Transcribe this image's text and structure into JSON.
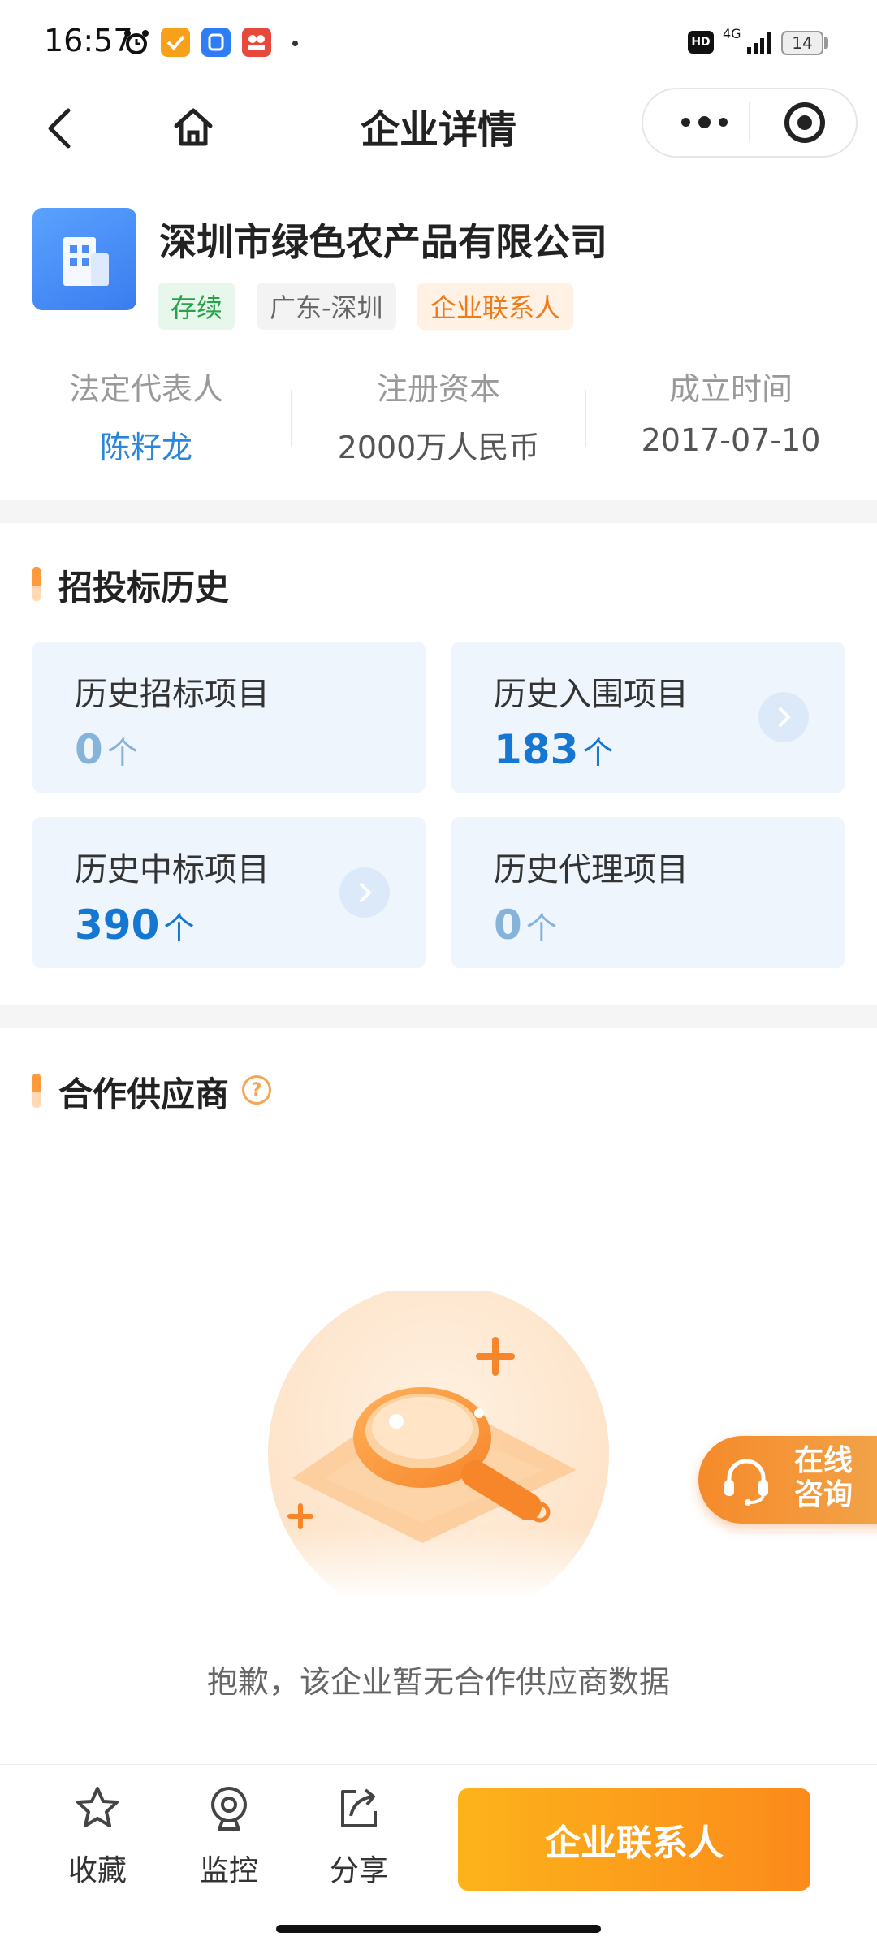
{
  "status_bar": {
    "time": "16:57",
    "hd": "HD",
    "network": "4G",
    "battery": "14"
  },
  "nav": {
    "title": "企业详情"
  },
  "company": {
    "name": "深圳市绿色农产品有限公司",
    "tags": {
      "status": "存续",
      "region": "广东-深圳",
      "contact": "企业联系人"
    },
    "stats": [
      {
        "label": "法定代表人",
        "value": "陈籽龙"
      },
      {
        "label": "注册资本",
        "value": "2000万人民币"
      },
      {
        "label": "成立时间",
        "value": "2017-07-10"
      }
    ]
  },
  "bidding": {
    "title": "招投标历史",
    "tiles": [
      {
        "label": "历史招标项目",
        "count": "0",
        "unit": "个"
      },
      {
        "label": "历史入围项目",
        "count": "183",
        "unit": "个"
      },
      {
        "label": "历史中标项目",
        "count": "390",
        "unit": "个"
      },
      {
        "label": "历史代理项目",
        "count": "0",
        "unit": "个"
      }
    ]
  },
  "suppliers": {
    "title": "合作供应商",
    "help": "?",
    "empty_message": "抱歉，该企业暂无合作供应商数据"
  },
  "float_consult": {
    "line1": "在线",
    "line2": "咨询"
  },
  "bottom_bar": {
    "favorite": "收藏",
    "monitor": "监控",
    "share": "分享",
    "contact_button": "企业联系人"
  },
  "colors": {
    "accent_orange": "#fb8a1b",
    "link_blue": "#2b86d8",
    "status_green": "#26a34a"
  }
}
